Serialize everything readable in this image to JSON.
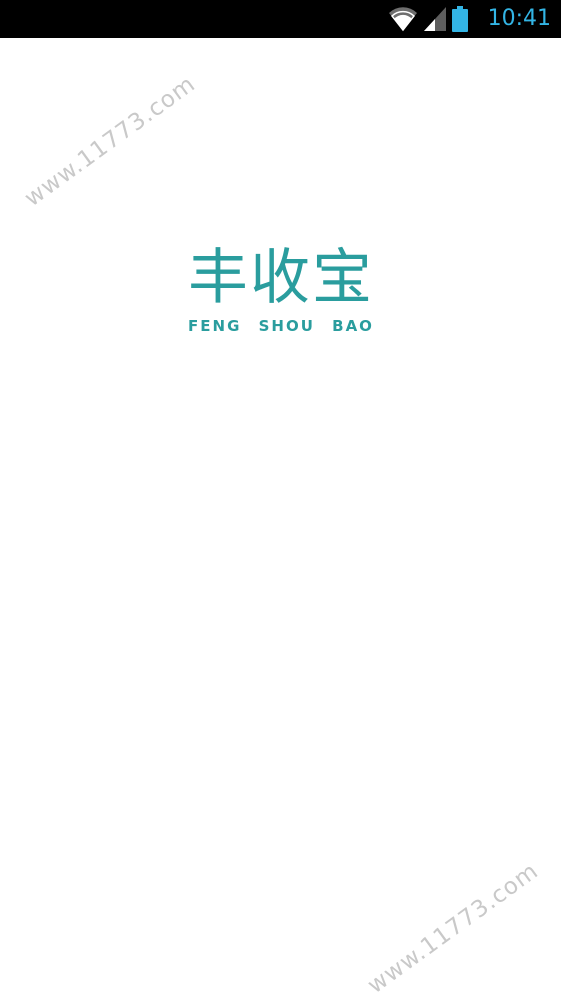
{
  "status_bar": {
    "time": "10:41",
    "icons": [
      "wifi-icon",
      "cell-signal-icon",
      "battery-icon"
    ],
    "time_color": "#33b5e5"
  },
  "splash": {
    "logo_title": "丰收宝",
    "logo_subtitle": "FENG SHOU BAO",
    "brand_color": "#2a9d9e"
  },
  "watermarks": [
    "www.11773.com",
    "www.11773.com"
  ]
}
